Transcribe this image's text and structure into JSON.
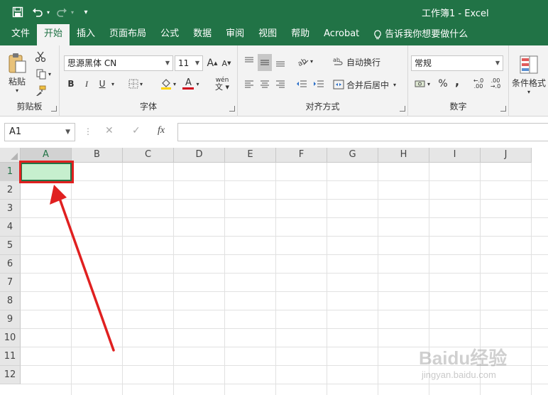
{
  "titlebar": {
    "title": "工作簿1  -  Excel"
  },
  "tabs": [
    {
      "label": "文件"
    },
    {
      "label": "开始"
    },
    {
      "label": "插入"
    },
    {
      "label": "页面布局"
    },
    {
      "label": "公式"
    },
    {
      "label": "数据"
    },
    {
      "label": "审阅"
    },
    {
      "label": "视图"
    },
    {
      "label": "帮助"
    },
    {
      "label": "Acrobat"
    },
    {
      "label": "告诉我你想要做什么"
    }
  ],
  "ribbon": {
    "clipboard": {
      "paste_label": "粘贴",
      "group_label": "剪贴板"
    },
    "font": {
      "font_name": "思源黑体 CN",
      "font_size": "11",
      "group_label": "字体",
      "bold": "B",
      "italic": "I",
      "underline": "U",
      "font_color": "A",
      "phonetic": "wén"
    },
    "alignment": {
      "wrap_text": "自动换行",
      "merge_center": "合并后居中",
      "group_label": "对齐方式"
    },
    "number": {
      "format": "常规",
      "percent": "%",
      "comma": ",",
      "group_label": "数字",
      "inc_decimal": "←.0 .00",
      "dec_decimal": ".00 →.0"
    },
    "styles": {
      "conditional_formatting": "条件格式"
    }
  },
  "formula_bar": {
    "name_box": "A1",
    "fx_label": "fx"
  },
  "grid": {
    "columns": [
      "A",
      "B",
      "C",
      "D",
      "E",
      "F",
      "G",
      "H",
      "I",
      "J"
    ],
    "rows": [
      "1",
      "2",
      "3",
      "4",
      "5",
      "6",
      "7",
      "8",
      "9",
      "10",
      "11",
      "12"
    ],
    "selected_cell": "A1",
    "selected_fill": "#c6efce"
  },
  "watermark": {
    "logo": "Baidu经验",
    "url": "jingyan.baidu.com"
  },
  "colors": {
    "accent": "#217346",
    "annotation": "#e02020"
  }
}
